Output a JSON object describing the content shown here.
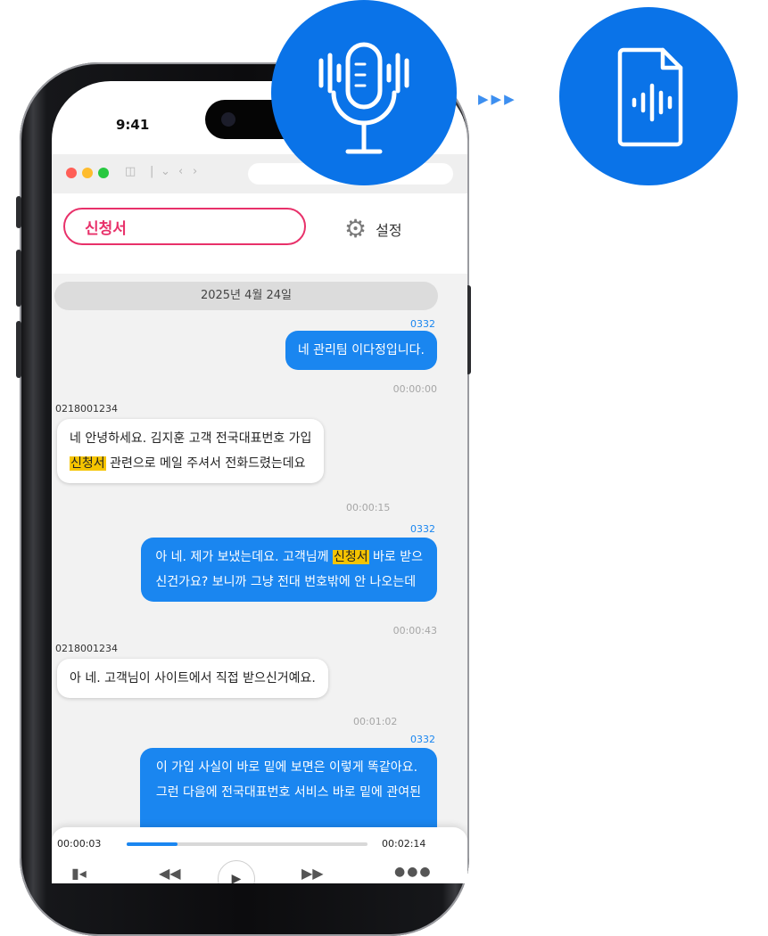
{
  "status_bar": {
    "time": "9:41"
  },
  "app": {
    "search_value": "신청서",
    "settings_label": "설정"
  },
  "chat": {
    "date": "2025년 4월 24일",
    "messages": [
      {
        "sender": "0332",
        "side": "me",
        "lines": [
          [
            "네 관리팀 이다정입니다."
          ]
        ],
        "time": "00:00:00"
      },
      {
        "sender": "0218001234",
        "side": "other",
        "lines": [
          [
            "네 안녕하세요. 김지훈 고객 전국대표번호 가입"
          ],
          [
            "",
            "신청서",
            " 관련으로 메일 주셔서 전화드렸는데요"
          ]
        ],
        "time": "00:00:15"
      },
      {
        "sender": "0332",
        "side": "me",
        "lines": [
          [
            "아 네. 제가 보냈는데요. 고객님께 ",
            "신청서",
            " 바로 받으"
          ],
          [
            "신건가요? 보니까 그냥 전대 번호밖에 안 나오는데"
          ]
        ],
        "time": "00:00:43"
      },
      {
        "sender": "0218001234",
        "side": "other",
        "lines": [
          [
            "아 네. 고객님이 사이트에서 직접 받으신거예요."
          ]
        ],
        "time": "00:01:02"
      },
      {
        "sender": "0332",
        "side": "me",
        "lines": [
          [
            "이 가입 사실이 바로 밑에 보면은 이렇게 똑같아요."
          ],
          [
            "그런 다음에 전국대표번호 서비스 바로 밑에 관여된"
          ]
        ],
        "time": ""
      }
    ]
  },
  "player": {
    "current_time": "00:00:03",
    "total_time": "00:02:14",
    "progress": 0.21,
    "controls": [
      "speaker-icon",
      "rewind-icon",
      "play-icon",
      "fast-forward-icon",
      "more-icon"
    ]
  },
  "colors": {
    "accent_blue": "#0a73e8",
    "bubble_blue": "#1a86f0",
    "highlight": "#f5c400",
    "search_border": "#e8316a"
  }
}
